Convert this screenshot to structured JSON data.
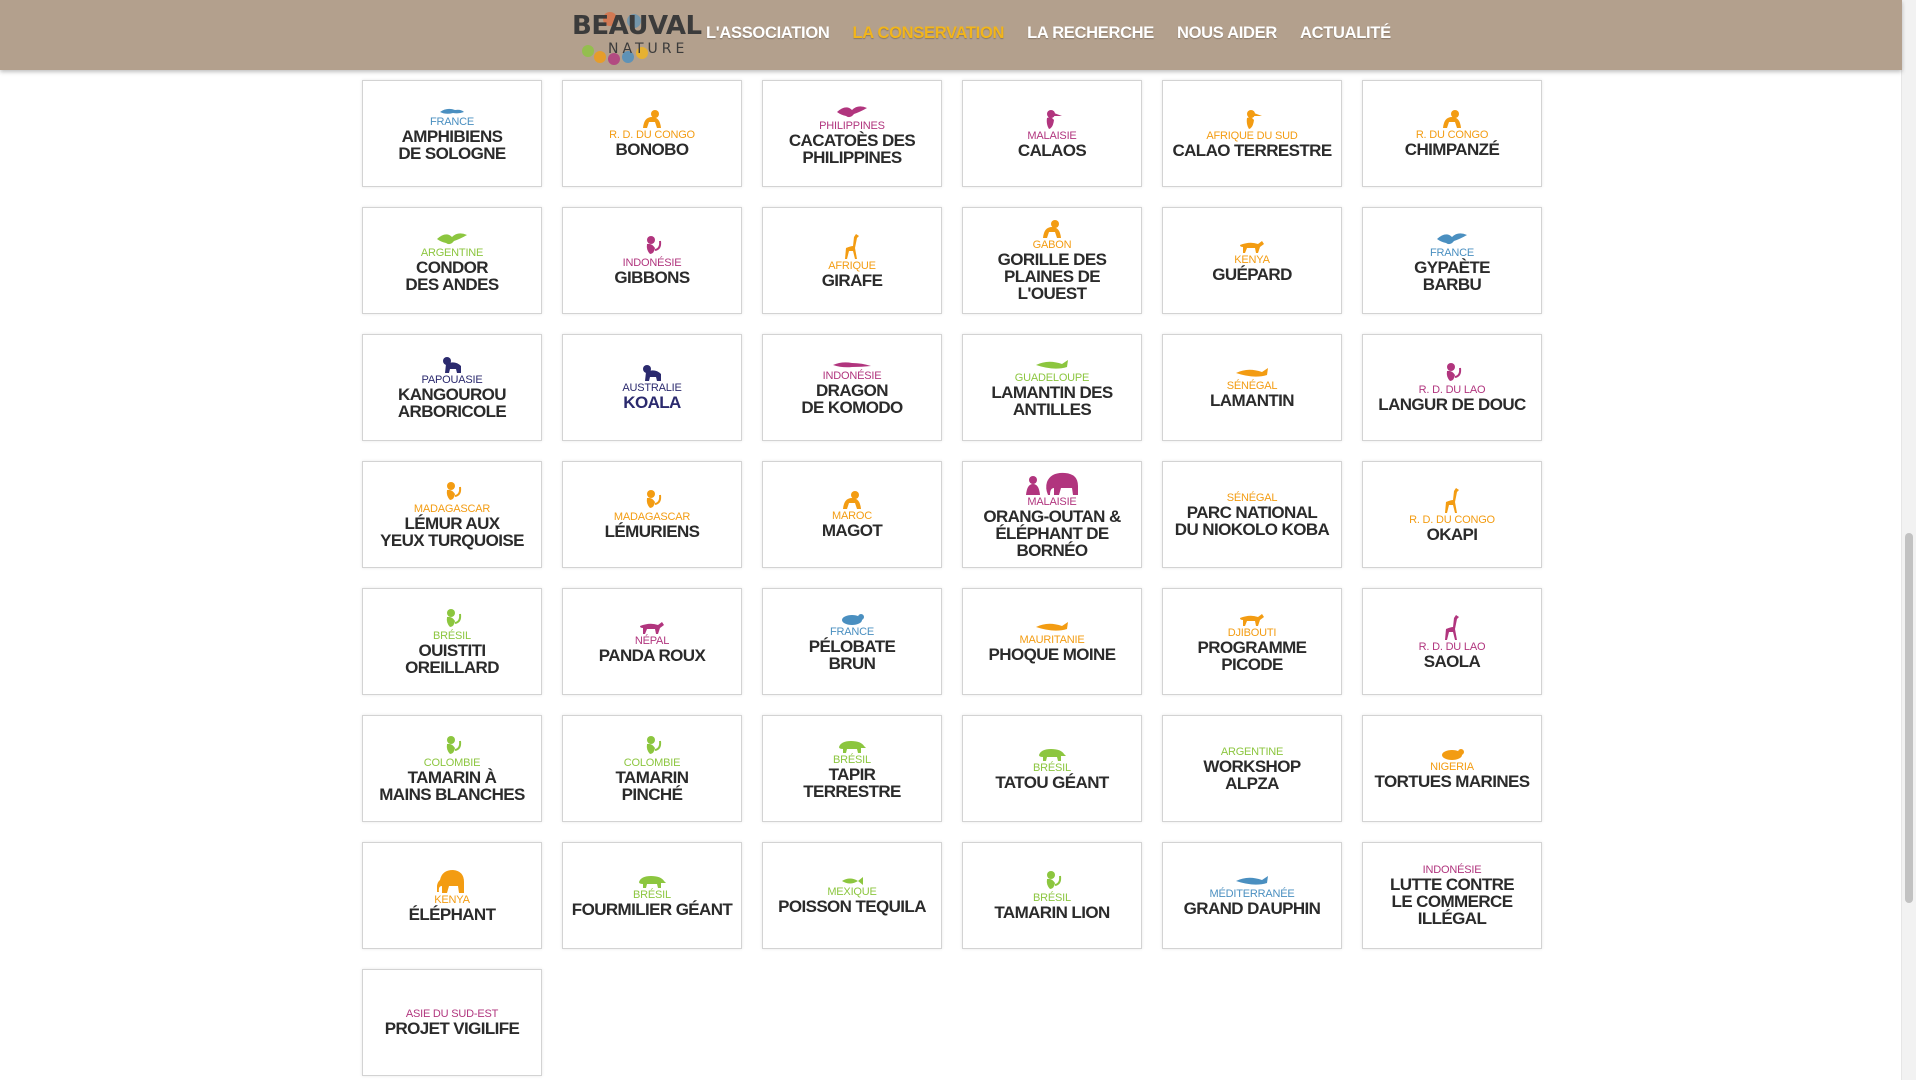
{
  "brand": {
    "name_line1": "BEAUVAL",
    "name_line2": "NATURE"
  },
  "nav": [
    {
      "label": "L'ASSOCIATION",
      "active": false
    },
    {
      "label": "LA CONSERVATION",
      "active": true
    },
    {
      "label": "LA RECHERCHE",
      "active": false
    },
    {
      "label": "NOUS AIDER",
      "active": false
    },
    {
      "label": "ACTUALITÉ",
      "active": false
    }
  ],
  "colors": {
    "header_bg": "#b3a08d",
    "nav_active": "#f2b51b",
    "blue": "#4a8fc0",
    "orange": "#f39c12",
    "purple": "#b1357e",
    "green": "#8cc63f",
    "navy": "#2b2a6e"
  },
  "programs": [
    {
      "country": "FRANCE",
      "title": "AMPHIBIENS\nDE SOLOGNE",
      "color": "#4a8fc0",
      "icon": "salamander-icon"
    },
    {
      "country": "R. D. DU CONGO",
      "title": "BONOBO",
      "color": "#f39c12",
      "icon": "bonobo-icon"
    },
    {
      "country": "PHILIPPINES",
      "title": "CACATOÈS DES\nPHILIPPINES",
      "color": "#b1357e",
      "icon": "cockatoo-icon"
    },
    {
      "country": "MALAISIE",
      "title": "CALAOS",
      "color": "#b1357e",
      "icon": "hornbill-icon"
    },
    {
      "country": "AFRIQUE DU SUD",
      "title": "CALAO TERRESTRE",
      "color": "#f39c12",
      "icon": "ground-hornbill-icon"
    },
    {
      "country": "R. DU CONGO",
      "title": "CHIMPANZÉ",
      "color": "#f39c12",
      "icon": "chimpanzee-icon"
    },
    {
      "country": "ARGENTINE",
      "title": "CONDOR\nDES ANDES",
      "color": "#8cc63f",
      "icon": "condor-icon"
    },
    {
      "country": "INDONÉSIE",
      "title": "GIBBONS",
      "color": "#b1357e",
      "icon": "gibbon-icon"
    },
    {
      "country": "AFRIQUE",
      "title": "GIRAFE",
      "color": "#f39c12",
      "icon": "giraffe-icon"
    },
    {
      "country": "GABON",
      "title": "GORILLE DES\nPLAINES DE\nL'OUEST",
      "color": "#f39c12",
      "icon": "gorilla-icon"
    },
    {
      "country": "KENYA",
      "title": "GUÉPARD",
      "color": "#f39c12",
      "icon": "cheetah-icon"
    },
    {
      "country": "FRANCE",
      "title": "GYPAÈTE\nBARBU",
      "color": "#4a8fc0",
      "icon": "vulture-icon"
    },
    {
      "country": "PAPOUASIE",
      "title": "KANGOUROU\nARBORICOLE",
      "color": "#2b2a6e",
      "icon": "tree-kangaroo-icon"
    },
    {
      "country": "AUSTRALIE",
      "title": "KOALA",
      "color": "#2b2a6e",
      "icon": "koala-icon"
    },
    {
      "country": "INDONÉSIE",
      "title": "DRAGON\nDE KOMODO",
      "color": "#b1357e",
      "icon": "komodo-icon"
    },
    {
      "country": "GUADELOUPE",
      "title": "LAMANTIN DES\nANTILLES",
      "color": "#8cc63f",
      "icon": "manatee-icon"
    },
    {
      "country": "SÉNÉGAL",
      "title": "LAMANTIN",
      "color": "#f39c12",
      "icon": "manatee-icon"
    },
    {
      "country": "R. D. DU LAO",
      "title": "LANGUR DE DOUC",
      "color": "#b1357e",
      "icon": "langur-icon"
    },
    {
      "country": "MADAGASCAR",
      "title": "LÉMUR AUX\nYEUX TURQUOISE",
      "color": "#f39c12",
      "icon": "lemur-icon"
    },
    {
      "country": "MADAGASCAR",
      "title": "LÉMURIENS",
      "color": "#f39c12",
      "icon": "lemur-icon"
    },
    {
      "country": "MAROC",
      "title": "MAGOT",
      "color": "#f39c12",
      "icon": "macaque-icon"
    },
    {
      "country": "MALAISIE",
      "title": "ORANG-OUTAN &\nÉLÉPHANT DE\nBORNÉO",
      "color": "#b1357e",
      "icon": "orangutan-elephant-icon"
    },
    {
      "country": "SÉNÉGAL",
      "title": "PARC NATIONAL\nDU NIOKOLO KOBA",
      "color": "#f39c12",
      "icon": ""
    },
    {
      "country": "R. D. DU CONGO",
      "title": "OKAPI",
      "color": "#f39c12",
      "icon": "okapi-icon"
    },
    {
      "country": "BRÉSIL",
      "title": "OUISTITI\nOREILLARD",
      "color": "#8cc63f",
      "icon": "marmoset-icon"
    },
    {
      "country": "NÉPAL",
      "title": "PANDA ROUX",
      "color": "#b1357e",
      "icon": "red-panda-icon"
    },
    {
      "country": "FRANCE",
      "title": "PÉLOBATE\nBRUN",
      "color": "#4a8fc0",
      "icon": "toad-icon"
    },
    {
      "country": "MAURITANIE",
      "title": "PHOQUE MOINE",
      "color": "#f39c12",
      "icon": "seal-icon"
    },
    {
      "country": "DJIBOUTI",
      "title": "PROGRAMME\nPICODE",
      "color": "#f39c12",
      "icon": "donkey-icon"
    },
    {
      "country": "R. D. DU LAO",
      "title": "SAOLA",
      "color": "#b1357e",
      "icon": "saola-icon"
    },
    {
      "country": "COLOMBIE",
      "title": "TAMARIN À\nMAINS BLANCHES",
      "color": "#8cc63f",
      "icon": "tamarin-icon"
    },
    {
      "country": "COLOMBIE",
      "title": "TAMARIN\nPINCHÉ",
      "color": "#8cc63f",
      "icon": "tamarin-icon"
    },
    {
      "country": "BRÉSIL",
      "title": "TAPIR\nTERRESTRE",
      "color": "#8cc63f",
      "icon": "tapir-icon"
    },
    {
      "country": "BRÉSIL",
      "title": "TATOU GÉANT",
      "color": "#8cc63f",
      "icon": "armadillo-icon"
    },
    {
      "country": "ARGENTINE",
      "title": "WORKSHOP\nALPZA",
      "color": "#8cc63f",
      "icon": ""
    },
    {
      "country": "NIGERIA",
      "title": "TORTUES MARINES",
      "color": "#f39c12",
      "icon": "turtle-icon"
    },
    {
      "country": "KENYA",
      "title": "ÉLÉPHANT",
      "color": "#f39c12",
      "icon": "elephant-icon"
    },
    {
      "country": "BRÉSIL",
      "title": "FOURMILIER GÉANT",
      "color": "#8cc63f",
      "icon": "anteater-icon"
    },
    {
      "country": "MEXIQUE",
      "title": "POISSON TEQUILA",
      "color": "#8cc63f",
      "icon": "fish-icon"
    },
    {
      "country": "BRÉSIL",
      "title": "TAMARIN LION",
      "color": "#8cc63f",
      "icon": "tamarin-icon"
    },
    {
      "country": "MÉDITERRANÉE",
      "title": "GRAND DAUPHIN",
      "color": "#4a8fc0",
      "icon": "dolphin-icon"
    },
    {
      "country": "INDONÉSIE",
      "title": "LUTTE CONTRE\nLE COMMERCE\nILLÉGAL",
      "color": "#b1357e",
      "icon": ""
    },
    {
      "country": "ASIE DU SUD-EST",
      "title": "PROJET VIGILIFE",
      "color": "#b1357e",
      "icon": ""
    }
  ]
}
